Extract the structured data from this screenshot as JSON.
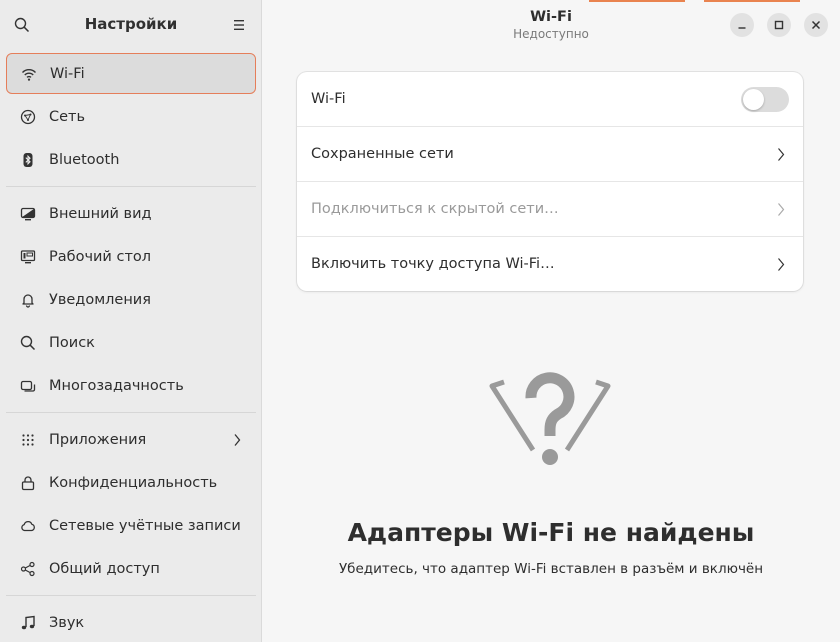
{
  "sidebar": {
    "title": "Настройки",
    "groups": [
      [
        {
          "label": "Wi-Fi",
          "icon": "wifi-icon",
          "active": true
        },
        {
          "label": "Сеть",
          "icon": "network-icon"
        },
        {
          "label": "Bluetooth",
          "icon": "bluetooth-icon"
        }
      ],
      [
        {
          "label": "Внешний вид",
          "icon": "appearance-icon"
        },
        {
          "label": "Рабочий стол",
          "icon": "desktop-icon"
        },
        {
          "label": "Уведомления",
          "icon": "bell-icon"
        },
        {
          "label": "Поиск",
          "icon": "search-icon"
        },
        {
          "label": "Многозадачность",
          "icon": "multitasking-icon"
        }
      ],
      [
        {
          "label": "Приложения",
          "icon": "apps-grid-icon",
          "has_chevron": true
        },
        {
          "label": "Конфиденциальность",
          "icon": "lock-icon"
        },
        {
          "label": "Сетевые учётные записи",
          "icon": "cloud-icon"
        },
        {
          "label": "Общий доступ",
          "icon": "share-icon"
        }
      ],
      [
        {
          "label": "Звук",
          "icon": "music-note-icon"
        }
      ]
    ]
  },
  "header": {
    "title": "Wi-Fi",
    "subtitle": "Недоступно"
  },
  "card": {
    "wifi_label": "Wi-Fi",
    "wifi_enabled": false,
    "saved_networks": "Сохраненные сети",
    "hidden_network": "Подключиться к скрытой сети…",
    "hotspot": "Включить точку доступа Wi-Fi…"
  },
  "empty_state": {
    "icon": "wifi-question-icon",
    "title": "Адаптеры Wi-Fi не найдены",
    "subtitle": "Убедитесь, что адаптер Wi-Fi вставлен в разъём и включён"
  },
  "colors": {
    "accent": "#e57e5a",
    "sidebar_bg": "#ebebeb",
    "main_bg": "#f6f6f6"
  }
}
